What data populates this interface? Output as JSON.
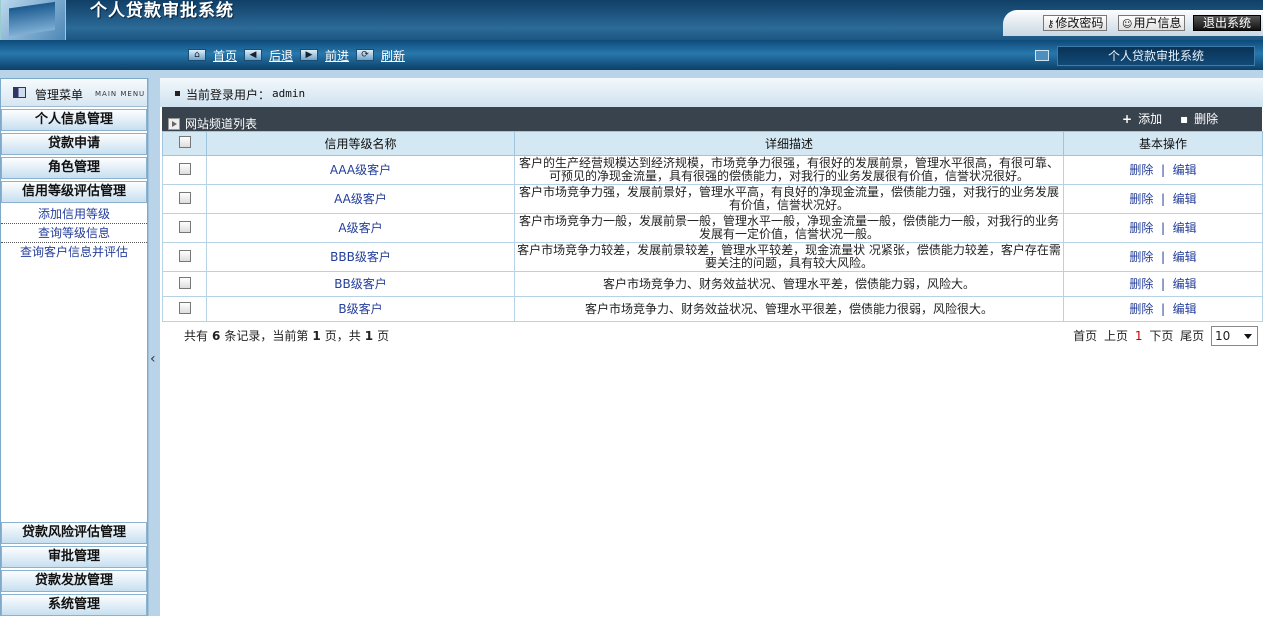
{
  "header": {
    "title": "个人贷款审批系统",
    "buttons": [
      {
        "label": "修改密码",
        "icon": "key-icon"
      },
      {
        "label": "用户信息",
        "icon": "user-icon"
      },
      {
        "label": "退出系统",
        "icon": ""
      }
    ]
  },
  "nav": {
    "items": [
      {
        "label": "首页",
        "icon": "home-icon"
      },
      {
        "label": "后退",
        "icon": "back-arrow-icon"
      },
      {
        "label": "前进",
        "icon": "forward-arrow-icon"
      },
      {
        "label": "刷新",
        "icon": "refresh-icon"
      }
    ],
    "right_title": "个人贷款审批系统"
  },
  "sidebar": {
    "title": "管理菜单",
    "title_en": "MAIN MENU",
    "top_menu": [
      "个人信息管理",
      "贷款申请",
      "角色管理",
      "信用等级评估管理"
    ],
    "sub_items": [
      "添加信用等级",
      "查询等级信息",
      "查询客户信息并评估"
    ],
    "bottom_menu": [
      "贷款风险评估管理",
      "审批管理",
      "贷款发放管理",
      "系统管理"
    ]
  },
  "main": {
    "user_label": "当前登录用户：",
    "user": "admin",
    "list_title": "网站频道列表",
    "add_label": "添加",
    "delete_label": "删除",
    "columns": [
      "信用等级名称",
      "详细描述",
      "基本操作"
    ],
    "rows": [
      {
        "name": "AAA级客户",
        "desc": "客户的生产经营规模达到经济规模，市场竞争力很强，有很好的发展前景，管理水平很高，有很可靠、可预见的净现金流量，具有很强的偿债能力，对我行的业务发展很有价值，信誉状况很好。"
      },
      {
        "name": "AA级客户",
        "desc": "客户市场竞争力强，发展前景好，管理水平高，有良好的净现金流量，偿债能力强，对我行的业务发展有价值，信誉状况好。"
      },
      {
        "name": "A级客户",
        "desc": "客户市场竞争力一般，发展前景一般，管理水平一般，净现金流量一般，偿债能力一般，对我行的业务发展有一定价值，信誉状况一般。"
      },
      {
        "name": "BBB级客户",
        "desc": "客户市场竞争力较差，发展前景较差，管理水平较差，现金流量状 况紧张，偿债能力较差，客户存在需要关注的问题，具有较大风险。"
      },
      {
        "name": "BB级客户",
        "desc": "客户市场竞争力、财务效益状况、管理水平差，偿债能力弱，风险大。"
      },
      {
        "name": "B级客户",
        "desc": "客户市场竞争力、财务效益状况、管理水平很差，偿债能力很弱，风险很大。"
      }
    ],
    "op_delete": "删除",
    "op_sep": "|",
    "op_edit": "编辑",
    "pager": {
      "total_prefix": "共有",
      "total": "6",
      "total_suffix": "条记录，当前第",
      "page": "1",
      "page_suffix": "页，共",
      "pages": "1",
      "pages_suffix": "页",
      "first": "首页",
      "prev": "上页",
      "current": "1",
      "next": "下页",
      "last": "尾页",
      "page_size": "10"
    }
  }
}
